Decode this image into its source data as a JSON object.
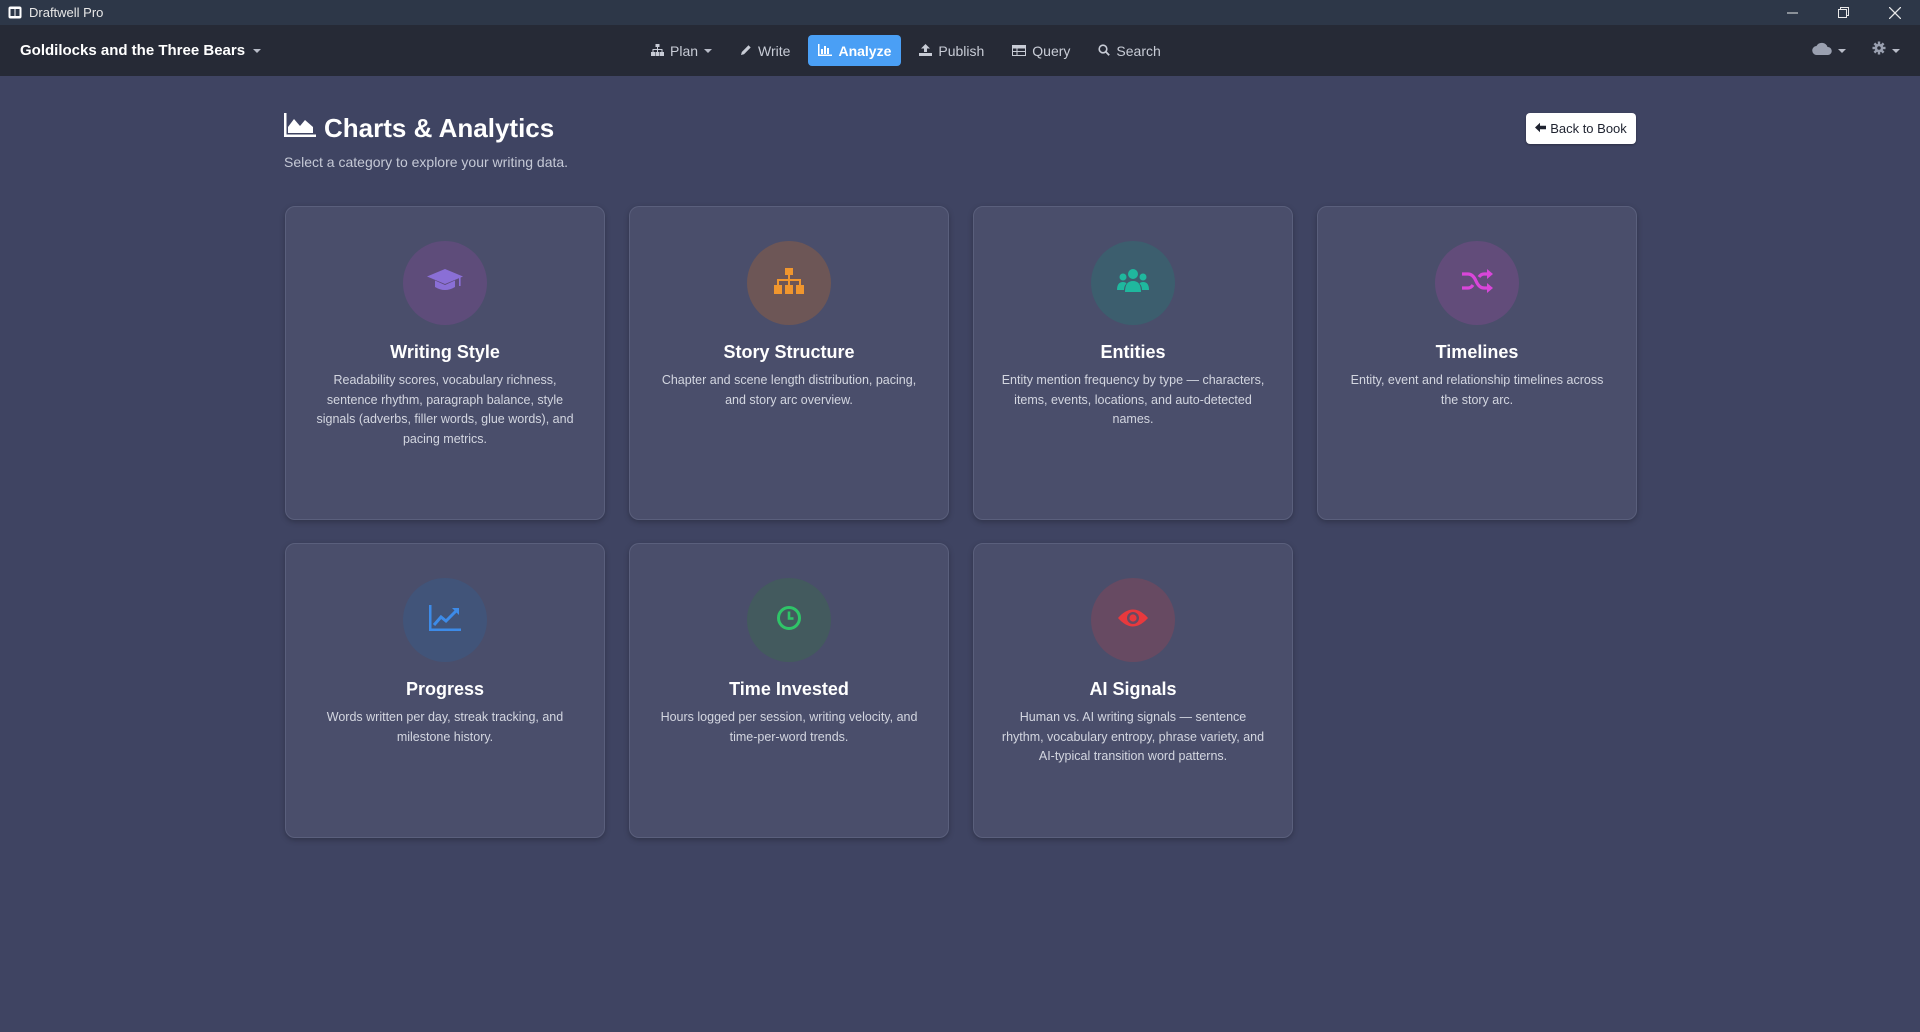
{
  "window": {
    "app_title": "Draftwell Pro"
  },
  "navbar": {
    "book_title": "Goldilocks and the Three Bears",
    "items": [
      {
        "label": "Plan",
        "icon": "sitemap-icon",
        "has_dropdown": true,
        "active": false
      },
      {
        "label": "Write",
        "icon": "pencil-icon",
        "has_dropdown": false,
        "active": false
      },
      {
        "label": "Analyze",
        "icon": "bar-chart-icon",
        "has_dropdown": false,
        "active": true
      },
      {
        "label": "Publish",
        "icon": "upload-icon",
        "has_dropdown": false,
        "active": false
      },
      {
        "label": "Query",
        "icon": "table-icon",
        "has_dropdown": false,
        "active": false
      },
      {
        "label": "Search",
        "icon": "search-icon",
        "has_dropdown": false,
        "active": false
      }
    ],
    "right_icons": [
      "cloud-icon",
      "gear-icon"
    ]
  },
  "header": {
    "title": "Charts & Analytics",
    "subtitle": "Select a category to explore your writing data.",
    "back_button": "Back to Book"
  },
  "cards": [
    {
      "title": "Writing Style",
      "icon": "graduation-cap-icon",
      "icon_color": "#8a6fd6",
      "circle_color": "#5e4c7a",
      "description": "Readability scores, vocabulary richness, sentence rhythm, paragraph balance, style signals (adverbs, filler words, glue words), and pacing metrics."
    },
    {
      "title": "Story Structure",
      "icon": "sitemap-icon",
      "icon_color": "#f0962e",
      "circle_color": "#6d5656",
      "description": "Chapter and scene length distribution, pacing, and story arc overview."
    },
    {
      "title": "Entities",
      "icon": "users-icon",
      "icon_color": "#1fb89e",
      "circle_color": "#3c5e6e",
      "description": "Entity mention frequency by type — characters, items, events, locations, and auto-detected names."
    },
    {
      "title": "Timelines",
      "icon": "shuffle-icon",
      "icon_color": "#d946d9",
      "circle_color": "#624c7a",
      "description": "Entity, event and relationship timelines across the story arc."
    },
    {
      "title": "Progress",
      "icon": "line-chart-icon",
      "icon_color": "#3d8be8",
      "circle_color": "#415479",
      "description": "Words written per day, streak tracking, and milestone history."
    },
    {
      "title": "Time Invested",
      "icon": "clock-icon",
      "icon_color": "#2fc468",
      "circle_color": "#435a5e",
      "description": "Hours logged per session, writing velocity, and time-per-word trends."
    },
    {
      "title": "AI Signals",
      "icon": "eye-icon",
      "icon_color": "#e8393d",
      "circle_color": "#674a62",
      "description": "Human vs. AI writing signals — sentence rhythm, vocabulary entropy, phrase variety, and AI-typical transition word patterns."
    }
  ]
}
